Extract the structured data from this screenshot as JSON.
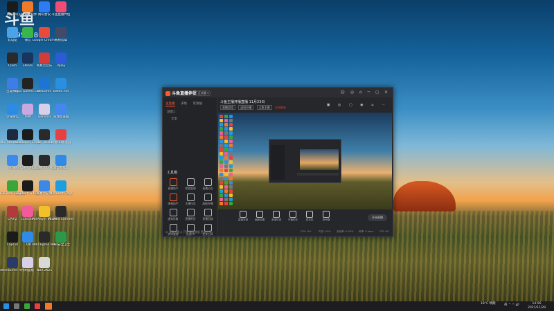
{
  "desktop": {
    "watermark": "斗鱼",
    "watermark_number": "5954186",
    "icons": [
      {
        "label": "腾讯QQ",
        "color": "#1b1b1b"
      },
      {
        "label": "火绒安全软件",
        "color": "#f07a2a"
      },
      {
        "label": "腾讯会议",
        "color": "#2f7bf5"
      },
      {
        "label": "斗鱼直播伴侣",
        "color": "#f04d74"
      },
      {
        "label": "此电脑",
        "color": "#4aa3e6"
      },
      {
        "label": "微信",
        "color": "#3ab54a"
      },
      {
        "label": "Google Chrome",
        "color": "#e84b3c"
      },
      {
        "label": "视频剪辑",
        "color": "#444a66"
      },
      {
        "label": "Clash",
        "color": "#2a2a2a"
      },
      {
        "label": "Steam",
        "color": "#18355e"
      },
      {
        "label": "网易云音乐",
        "color": "#d33b3b"
      },
      {
        "label": "Uplay",
        "color": "#2d5bd6"
      },
      {
        "label": "百度网盘",
        "color": "#3d7ee6"
      },
      {
        "label": "Epic Games Launcher",
        "color": "#222222"
      },
      {
        "label": "WeGame",
        "color": "#1e74d3"
      },
      {
        "label": "Battle.net",
        "color": "#2a8fe0"
      },
      {
        "label": "企业微信",
        "color": "#2c8be6"
      },
      {
        "label": "原神",
        "color": "#c8a8e0"
      },
      {
        "label": "Genshin",
        "color": "#d8d0e8"
      },
      {
        "label": "游戏加速器",
        "color": "#4488ee"
      },
      {
        "label": "MSI Afterburner",
        "color": "#1f2a3f"
      },
      {
        "label": "Wallpaper Engine",
        "color": "#1b1b1b"
      },
      {
        "label": "OBS Studio",
        "color": "#2a2a2a"
      },
      {
        "label": "网易UU加速器",
        "color": "#e84040"
      },
      {
        "label": "迅雷",
        "color": "#3c8af0"
      },
      {
        "label": "NVIDIA GeForce",
        "color": "#1b1b1b"
      },
      {
        "label": "Logitech G HUB",
        "color": "#2a2a2a"
      },
      {
        "label": "雷电模拟器",
        "color": "#2f8ae8"
      },
      {
        "label": "GeForce Experience",
        "color": "#3aa63a"
      },
      {
        "label": "Logitech G HUB",
        "color": "#1b1b1b"
      },
      {
        "label": "网易云游戏",
        "color": "#3d88e6"
      },
      {
        "label": "Microsoft Edge",
        "color": "#1e9de0"
      },
      {
        "label": "CPU-Z",
        "color": "#b33a3a"
      },
      {
        "label": "CCleaner",
        "color": "#f25a9a"
      },
      {
        "label": "PotPlayer 64 bit",
        "color": "#f2c12a"
      },
      {
        "label": "AIDA64 Extreme",
        "color": "#2a2a2a"
      },
      {
        "label": "CapCut",
        "color": "#1b1b1b"
      },
      {
        "label": "飞书",
        "color": "#2f8ae8"
      },
      {
        "label": "AMD Ryzen Master",
        "color": "#2a2a2a"
      },
      {
        "label": "360安全卫士",
        "color": "#2a9a4a"
      },
      {
        "label": "Afterburner RTSS",
        "color": "#2a3a6a"
      },
      {
        "label": "控制面板",
        "color": "#d8d0e8"
      },
      {
        "label": "NBA 2K21",
        "color": "#d8d8d8"
      }
    ]
  },
  "app": {
    "brand": "斗鱼直播伴侣",
    "version_badge": "正式版 ▾",
    "window_controls": "☺ ◎ ⌂ ─ ◻ ✕",
    "sidebar": {
      "tabs": [
        "主直播",
        "子场",
        "可添加"
      ],
      "scenes": [
        "场景1",
        "文本"
      ],
      "tools_title": "工具箱",
      "tools": [
        {
          "label": "直播助手"
        },
        {
          "label": "房管管理"
        },
        {
          "label": "直播公告"
        },
        {
          "label": "弹幕助手"
        },
        {
          "label": "主播任务"
        },
        {
          "label": "高能开播"
        },
        {
          "label": "虚拟形象"
        },
        {
          "label": "直播带货"
        },
        {
          "label": "直播回放"
        },
        {
          "label": "房间管理"
        },
        {
          "label": "连麦PK"
        },
        {
          "label": "更多工具"
        }
      ],
      "footer": "⚙ 斗鱼主播   ◎ 开播·观看数据   更多主播 ›"
    },
    "stream": {
      "title": "斗鱼主播开播直播 11月23日",
      "tags": [
        "直播游戏",
        "虚拟开播",
        "斗鱼主播"
      ],
      "sub_note": "正在推流",
      "head_icons": "▣ ◎ ▢ ◉ ⌂ ⋯"
    },
    "bottom_bar": [
      {
        "label": "直播录制"
      },
      {
        "label": "画面设置"
      },
      {
        "label": "多媒体源"
      },
      {
        "label": "开播助手"
      },
      {
        "label": "麦克风"
      },
      {
        "label": "扬声器"
      }
    ],
    "start_button": "开始直播",
    "status": [
      "CPU: 8%",
      "内存: 42%",
      "丢帧率: 0.00%",
      "码率: 0 kbps",
      "FPS: 60"
    ]
  },
  "taskbar": {
    "weather": "18°C 晴朗",
    "time": "14:56",
    "date": "2021/11/28",
    "tray": "英 ⌃ ◠ 🔊"
  }
}
